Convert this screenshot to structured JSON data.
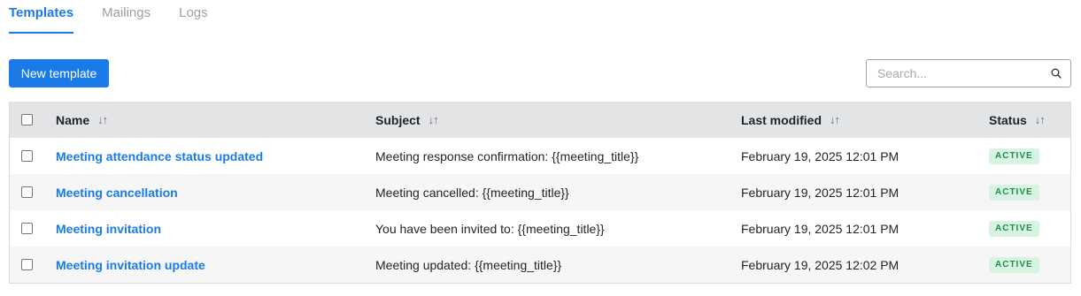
{
  "tabs": [
    {
      "label": "Templates",
      "active": true
    },
    {
      "label": "Mailings",
      "active": false
    },
    {
      "label": "Logs",
      "active": false
    }
  ],
  "toolbar": {
    "new_button": "New template",
    "search_placeholder": "Search...",
    "search_value": "",
    "search_icon": "search-icon"
  },
  "table": {
    "columns": [
      {
        "label": "Name",
        "sort_icon": "↓↑"
      },
      {
        "label": "Subject",
        "sort_icon": "↓↑"
      },
      {
        "label": "Last modified",
        "sort_icon": "↓↑"
      },
      {
        "label": "Status",
        "sort_icon": "↓↑"
      }
    ],
    "rows": [
      {
        "name": "Meeting attendance status updated",
        "subject": "Meeting response confirmation: {{meeting_title}}",
        "modified": "February 19, 2025 12:01 PM",
        "status": "ACTIVE"
      },
      {
        "name": "Meeting cancellation",
        "subject": "Meeting cancelled: {{meeting_title}}",
        "modified": "February 19, 2025 12:01 PM",
        "status": "ACTIVE"
      },
      {
        "name": "Meeting invitation",
        "subject": "You have been invited to: {{meeting_title}}",
        "modified": "February 19, 2025 12:01 PM",
        "status": "ACTIVE"
      },
      {
        "name": "Meeting invitation update",
        "subject": "Meeting updated: {{meeting_title}}",
        "modified": "February 19, 2025 12:02 PM",
        "status": "ACTIVE"
      }
    ]
  },
  "colors": {
    "accent": "#1a7ae8",
    "header_bg": "#e2e4e6",
    "badge_bg": "#d8f3e1",
    "badge_text": "#1e8e4a"
  }
}
